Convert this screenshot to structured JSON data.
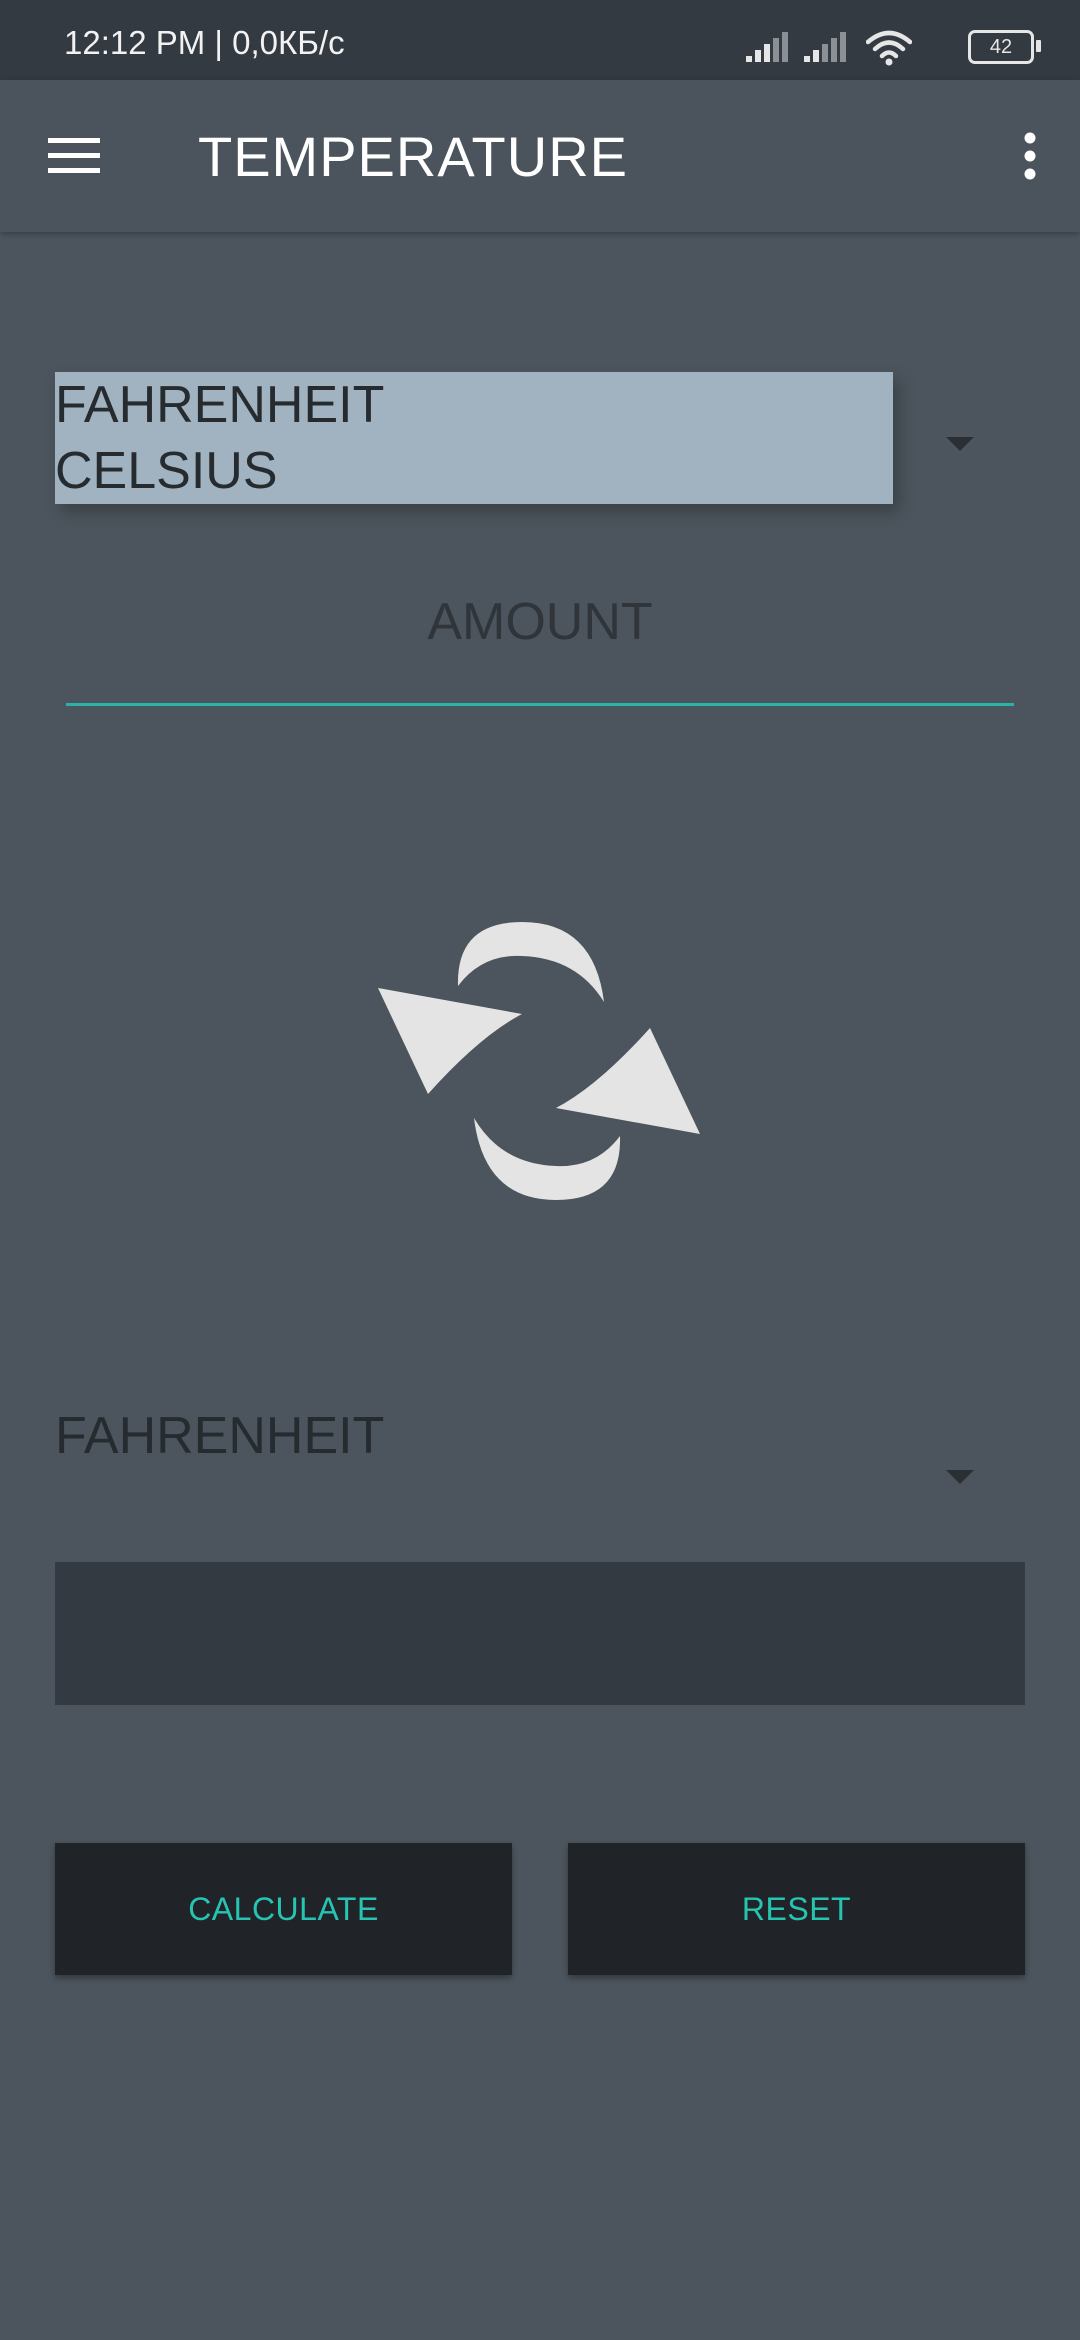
{
  "status_bar": {
    "time": "12:12 PM | 0,0КБ/с",
    "battery": "42"
  },
  "app_bar": {
    "title": "TEMPERATURE",
    "menu_icon": "hamburger-menu-icon",
    "overflow_icon": "more-vertical-icon"
  },
  "from_spinner": {
    "options": [
      "FAHRENHEIT",
      "CELSIUS"
    ]
  },
  "amount": {
    "placeholder": "AMOUNT"
  },
  "swap": {
    "icon": "swap-arrows-icon"
  },
  "to_spinner": {
    "selected": "FAHRENHEIT"
  },
  "result": {
    "value": ""
  },
  "buttons": {
    "calculate_label": "CALCULATE",
    "reset_label": "RESET"
  },
  "colors": {
    "background": "#4c555d",
    "status_bar": "#343a41",
    "dropdown_options": "#a1b3c1",
    "accent": "#26c4b1",
    "button_bg": "#202428",
    "result_bg": "#343a41"
  }
}
